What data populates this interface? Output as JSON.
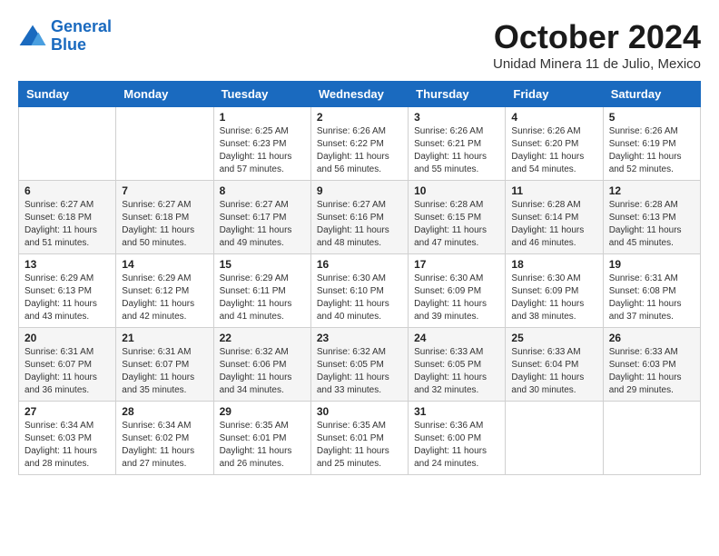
{
  "header": {
    "logo": {
      "line1": "General",
      "line2": "Blue"
    },
    "title": "October 2024",
    "location": "Unidad Minera 11 de Julio, Mexico"
  },
  "weekdays": [
    "Sunday",
    "Monday",
    "Tuesday",
    "Wednesday",
    "Thursday",
    "Friday",
    "Saturday"
  ],
  "weeks": [
    [
      {
        "day": "",
        "content": ""
      },
      {
        "day": "",
        "content": ""
      },
      {
        "day": "1",
        "content": "Sunrise: 6:25 AM\nSunset: 6:23 PM\nDaylight: 11 hours and 57 minutes."
      },
      {
        "day": "2",
        "content": "Sunrise: 6:26 AM\nSunset: 6:22 PM\nDaylight: 11 hours and 56 minutes."
      },
      {
        "day": "3",
        "content": "Sunrise: 6:26 AM\nSunset: 6:21 PM\nDaylight: 11 hours and 55 minutes."
      },
      {
        "day": "4",
        "content": "Sunrise: 6:26 AM\nSunset: 6:20 PM\nDaylight: 11 hours and 54 minutes."
      },
      {
        "day": "5",
        "content": "Sunrise: 6:26 AM\nSunset: 6:19 PM\nDaylight: 11 hours and 52 minutes."
      }
    ],
    [
      {
        "day": "6",
        "content": "Sunrise: 6:27 AM\nSunset: 6:18 PM\nDaylight: 11 hours and 51 minutes."
      },
      {
        "day": "7",
        "content": "Sunrise: 6:27 AM\nSunset: 6:18 PM\nDaylight: 11 hours and 50 minutes."
      },
      {
        "day": "8",
        "content": "Sunrise: 6:27 AM\nSunset: 6:17 PM\nDaylight: 11 hours and 49 minutes."
      },
      {
        "day": "9",
        "content": "Sunrise: 6:27 AM\nSunset: 6:16 PM\nDaylight: 11 hours and 48 minutes."
      },
      {
        "day": "10",
        "content": "Sunrise: 6:28 AM\nSunset: 6:15 PM\nDaylight: 11 hours and 47 minutes."
      },
      {
        "day": "11",
        "content": "Sunrise: 6:28 AM\nSunset: 6:14 PM\nDaylight: 11 hours and 46 minutes."
      },
      {
        "day": "12",
        "content": "Sunrise: 6:28 AM\nSunset: 6:13 PM\nDaylight: 11 hours and 45 minutes."
      }
    ],
    [
      {
        "day": "13",
        "content": "Sunrise: 6:29 AM\nSunset: 6:13 PM\nDaylight: 11 hours and 43 minutes."
      },
      {
        "day": "14",
        "content": "Sunrise: 6:29 AM\nSunset: 6:12 PM\nDaylight: 11 hours and 42 minutes."
      },
      {
        "day": "15",
        "content": "Sunrise: 6:29 AM\nSunset: 6:11 PM\nDaylight: 11 hours and 41 minutes."
      },
      {
        "day": "16",
        "content": "Sunrise: 6:30 AM\nSunset: 6:10 PM\nDaylight: 11 hours and 40 minutes."
      },
      {
        "day": "17",
        "content": "Sunrise: 6:30 AM\nSunset: 6:09 PM\nDaylight: 11 hours and 39 minutes."
      },
      {
        "day": "18",
        "content": "Sunrise: 6:30 AM\nSunset: 6:09 PM\nDaylight: 11 hours and 38 minutes."
      },
      {
        "day": "19",
        "content": "Sunrise: 6:31 AM\nSunset: 6:08 PM\nDaylight: 11 hours and 37 minutes."
      }
    ],
    [
      {
        "day": "20",
        "content": "Sunrise: 6:31 AM\nSunset: 6:07 PM\nDaylight: 11 hours and 36 minutes."
      },
      {
        "day": "21",
        "content": "Sunrise: 6:31 AM\nSunset: 6:07 PM\nDaylight: 11 hours and 35 minutes."
      },
      {
        "day": "22",
        "content": "Sunrise: 6:32 AM\nSunset: 6:06 PM\nDaylight: 11 hours and 34 minutes."
      },
      {
        "day": "23",
        "content": "Sunrise: 6:32 AM\nSunset: 6:05 PM\nDaylight: 11 hours and 33 minutes."
      },
      {
        "day": "24",
        "content": "Sunrise: 6:33 AM\nSunset: 6:05 PM\nDaylight: 11 hours and 32 minutes."
      },
      {
        "day": "25",
        "content": "Sunrise: 6:33 AM\nSunset: 6:04 PM\nDaylight: 11 hours and 30 minutes."
      },
      {
        "day": "26",
        "content": "Sunrise: 6:33 AM\nSunset: 6:03 PM\nDaylight: 11 hours and 29 minutes."
      }
    ],
    [
      {
        "day": "27",
        "content": "Sunrise: 6:34 AM\nSunset: 6:03 PM\nDaylight: 11 hours and 28 minutes."
      },
      {
        "day": "28",
        "content": "Sunrise: 6:34 AM\nSunset: 6:02 PM\nDaylight: 11 hours and 27 minutes."
      },
      {
        "day": "29",
        "content": "Sunrise: 6:35 AM\nSunset: 6:01 PM\nDaylight: 11 hours and 26 minutes."
      },
      {
        "day": "30",
        "content": "Sunrise: 6:35 AM\nSunset: 6:01 PM\nDaylight: 11 hours and 25 minutes."
      },
      {
        "day": "31",
        "content": "Sunrise: 6:36 AM\nSunset: 6:00 PM\nDaylight: 11 hours and 24 minutes."
      },
      {
        "day": "",
        "content": ""
      },
      {
        "day": "",
        "content": ""
      }
    ]
  ]
}
